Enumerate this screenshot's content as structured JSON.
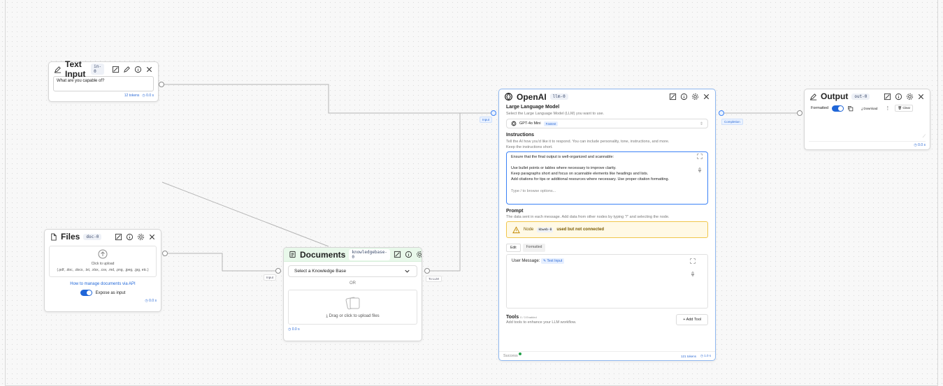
{
  "nodes": {
    "text_input": {
      "title": "Text Input",
      "id": "in-0",
      "value": "What are you capable of?",
      "tokens": "12 tokens",
      "time": "0.0 s"
    },
    "files": {
      "title": "Files",
      "id": "doc-0",
      "upload_text": "Click to upload",
      "formats": "(.pdf, .doc, .docx, .txt, .xlsx, .csv, .md, .png, .jpeg, .jpg, etc.)",
      "manage_link": "How to manage documents via API",
      "expose_label": "Expose as input",
      "time": "0.0 s"
    },
    "documents": {
      "title": "Documents",
      "id": "knowledgebase-0",
      "select_label": "Select a Knowledge Base",
      "or_text": "OR",
      "upload_text": "Drag or click to upload files",
      "time": "0.0 s",
      "input_port": "Input",
      "output_port": "To LLM"
    },
    "openai": {
      "title": "OpenAI",
      "id": "llm-0",
      "input_port": "Input",
      "output_port": "Completion",
      "llm_title": "Large Language Model",
      "llm_desc": "Select the Large Language Model (LLM) you want to use.",
      "model_name": "GPT-4o Mini",
      "model_badge": "Fastest",
      "instructions_title": "Instructions",
      "instructions_desc_1": "Tell the AI how you'd like it to respond. You can include personality, tone, instructions, and more.",
      "instructions_desc_2": "Keep the instructions short.",
      "instructions_lines": [
        "Ensure that the final output is well-organized and scannable:",
        "",
        "Use bullet points or tables where necessary to improve clarity.",
        "Keep paragraphs short and focus on scannable elements like headings and lists.",
        "Add citations for tips or additional resources where necessary. Use proper citation formatting."
      ],
      "instructions_placeholder": "Type  /  to browse options...",
      "prompt_title": "Prompt",
      "prompt_desc": "The data sent in each message. Add data from other nodes by typing \"/\" and selecting the node.",
      "warning_prefix": "Node",
      "warning_node": "kbweb-0",
      "warning_suffix": "used but not connected",
      "tab_edit": "Edit",
      "tab_formatted": "Formatted",
      "user_message_label": "User Message:",
      "user_message_ref": "Text Input",
      "tools_title": "Tools",
      "tools_enabled": "0 / 3 Enabled",
      "tools_desc": "Add tools to enhance your LLM workflow.",
      "add_tool": "+ Add Tool",
      "status": "Success",
      "tokens": "121 tokens",
      "time": "1.0 s"
    },
    "output": {
      "title": "Output",
      "id": "out-0",
      "formatted_label": "Formatted",
      "download_label": "Download",
      "clear_label": "Clear",
      "time": "0.0 s"
    }
  },
  "colors": {
    "accent": "#1f66d8",
    "edge": "#b5b5b5",
    "documents_header": "#e8f8ea",
    "warning_bg": "#fff9e5",
    "warning_border": "#f0c64b",
    "success": "#22a049"
  }
}
